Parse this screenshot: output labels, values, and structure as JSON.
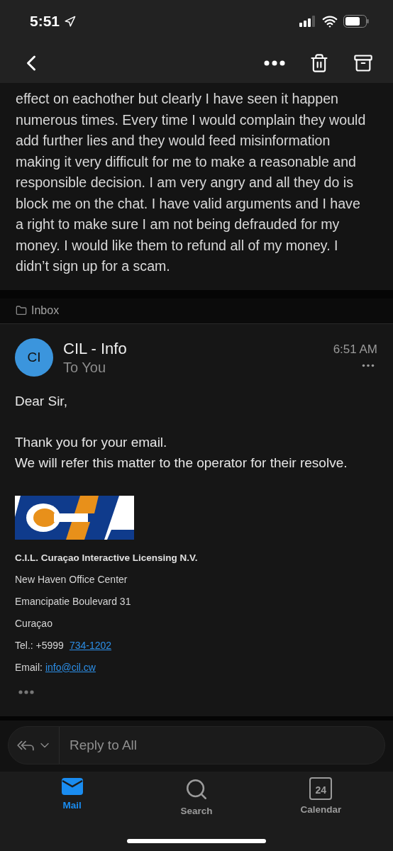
{
  "status_bar": {
    "time": "5:51"
  },
  "previous_message": {
    "body": "effect on eachother but clearly I have seen it happen numerous times. Every time I would complain they would add further lies and they would feed misinformation making it very difficult for me to make a reasonable and responsible decision. I am very  angry and all they do is block me on the chat. I have valid arguments and I have a right to make sure I am not being defrauded for my money. I would like them to refund all of my money. I didn’t sign up for a scam."
  },
  "folder": {
    "label": "Inbox"
  },
  "message": {
    "avatar_initials": "CI",
    "sender": "CIL - Info",
    "recipient": "To You",
    "time": "6:51 AM",
    "greeting": "Dear Sir,",
    "lines": [
      "Thank you for your email.",
      "We will refer this matter to the operator for their resolve."
    ]
  },
  "signature": {
    "company": "C.I.L. Curaçao Interactive Licensing N.V.",
    "address": [
      "New Haven Office Center",
      "Emancipatie Boulevard 31",
      "Curaçao"
    ],
    "phone_label": "Tel.: +5999",
    "phone": "734-1202",
    "email_label": "Email:",
    "email": "info@cil.cw"
  },
  "reply": {
    "placeholder": "Reply to All"
  },
  "tabs": [
    {
      "kind": "mail",
      "label": "Mail",
      "selected": true
    },
    {
      "kind": "search",
      "label": "Search",
      "selected": false
    },
    {
      "kind": "calendar",
      "label": "Calendar",
      "selected": false,
      "day": "24"
    }
  ]
}
